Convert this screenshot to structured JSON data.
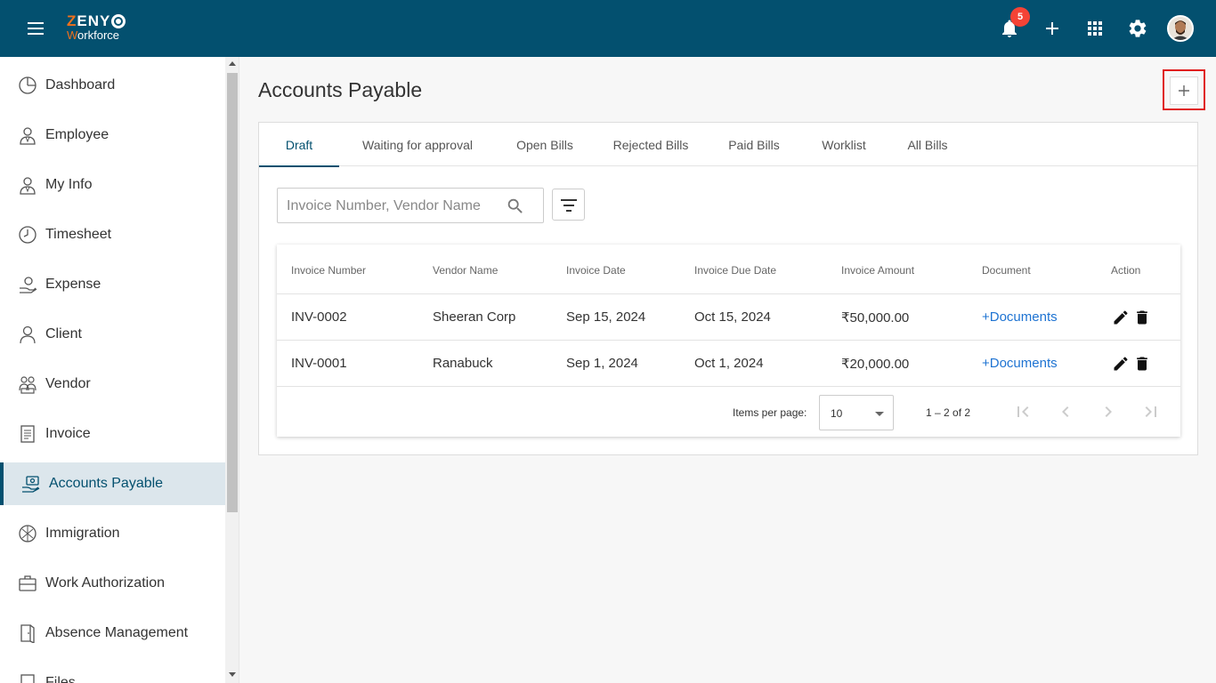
{
  "header": {
    "logo_zeny": "ZENY",
    "logo_w": "W",
    "logo_orkforce": "orkforce",
    "notification_count": "5"
  },
  "sidebar": {
    "items": [
      {
        "label": "Dashboard",
        "icon": "dashboard-icon"
      },
      {
        "label": "Employee",
        "icon": "employee-icon"
      },
      {
        "label": "My Info",
        "icon": "my-info-icon"
      },
      {
        "label": "Timesheet",
        "icon": "clock-icon"
      },
      {
        "label": "Expense",
        "icon": "expense-icon"
      },
      {
        "label": "Client",
        "icon": "client-icon"
      },
      {
        "label": "Vendor",
        "icon": "vendor-icon"
      },
      {
        "label": "Invoice",
        "icon": "invoice-icon"
      },
      {
        "label": "Accounts Payable",
        "icon": "accounts-payable-icon",
        "active": true
      },
      {
        "label": "Immigration",
        "icon": "immigration-icon"
      },
      {
        "label": "Work Authorization",
        "icon": "briefcase-icon"
      },
      {
        "label": "Absence Management",
        "icon": "absence-icon"
      },
      {
        "label": "Files",
        "icon": "files-icon"
      }
    ]
  },
  "main": {
    "title": "Accounts Payable",
    "tabs": [
      {
        "label": "Draft",
        "active": true
      },
      {
        "label": "Waiting for approval"
      },
      {
        "label": "Open Bills"
      },
      {
        "label": "Rejected Bills"
      },
      {
        "label": "Paid Bills"
      },
      {
        "label": "Worklist"
      },
      {
        "label": "All Bills"
      }
    ],
    "search": {
      "placeholder": "Invoice Number, Vendor Name",
      "value": ""
    },
    "table": {
      "columns": [
        "Invoice Number",
        "Vendor Name",
        "Invoice Date",
        "Invoice Due Date",
        "Invoice Amount",
        "Document",
        "Action"
      ],
      "rows": [
        {
          "invoice_number": "INV-0002",
          "vendor_name": "Sheeran Corp",
          "invoice_date": "Sep 15, 2024",
          "due_date": "Oct 15, 2024",
          "amount": "₹50,000.00",
          "document": "+Documents"
        },
        {
          "invoice_number": "INV-0001",
          "vendor_name": "Ranabuck",
          "invoice_date": "Sep 1, 2024",
          "due_date": "Oct 1, 2024",
          "amount": "₹20,000.00",
          "document": "+Documents"
        }
      ]
    },
    "paginator": {
      "items_per_page_label": "Items per page:",
      "items_per_page": "10",
      "range": "1 – 2 of 2"
    }
  },
  "colors": {
    "header_bg": "#03506f",
    "accent": "#03506f",
    "link": "#1e73d2",
    "badge": "#f44336",
    "highlight_box": "#e01b1b"
  }
}
